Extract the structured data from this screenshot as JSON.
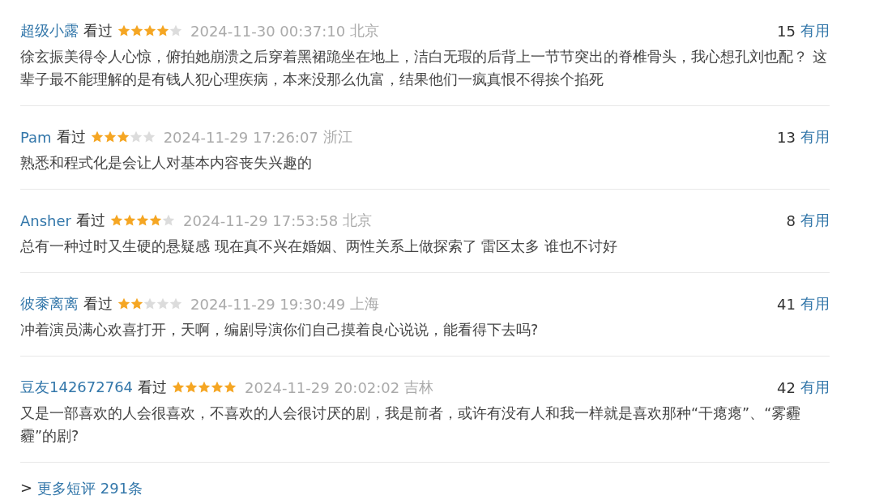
{
  "comments": [
    {
      "user": "超级小露",
      "status": "看过",
      "stars": 4,
      "time": "2024-11-30 00:37:10",
      "location": "北京",
      "votes": "15",
      "vote_label": "有用",
      "text": "徐玄振美得令人心惊，俯拍她崩溃之后穿着黑裙跪坐在地上，洁白无瑕的后背上一节节突出的脊椎骨头，我心想孔刘也配？ 这辈子最不能理解的是有钱人犯心理疾病，本来没那么仇富，结果他们一疯真恨不得挨个掐死"
    },
    {
      "user": "Pam",
      "status": "看过",
      "stars": 3,
      "time": "2024-11-29 17:26:07",
      "location": "浙江",
      "votes": "13",
      "vote_label": "有用",
      "text": "熟悉和程式化是会让人对基本内容丧失兴趣的"
    },
    {
      "user": "Ansher",
      "status": "看过",
      "stars": 4,
      "time": "2024-11-29 17:53:58",
      "location": "北京",
      "votes": "8",
      "vote_label": "有用",
      "text": "总有一种过时又生硬的悬疑感 现在真不兴在婚姻、两性关系上做探索了 雷区太多 谁也不讨好"
    },
    {
      "user": "彼黍离离",
      "status": "看过",
      "stars": 2,
      "time": "2024-11-29 19:30:49",
      "location": "上海",
      "votes": "41",
      "vote_label": "有用",
      "text": "冲着演员满心欢喜打开，天啊，编剧导演你们自己摸着良心说说，能看得下去吗?"
    },
    {
      "user": "豆友142672764",
      "status": "看过",
      "stars": 5,
      "time": "2024-11-29 20:02:02",
      "location": "吉林",
      "votes": "42",
      "vote_label": "有用",
      "text": "又是一部喜欢的人会很喜欢，不喜欢的人会很讨厌的剧，我是前者，或许有没有人和我一样就是喜欢那种“干瘪瘪”、“雾霾霾”的剧?"
    }
  ],
  "more": {
    "arrow": ">",
    "label": "更多短评 291条"
  }
}
